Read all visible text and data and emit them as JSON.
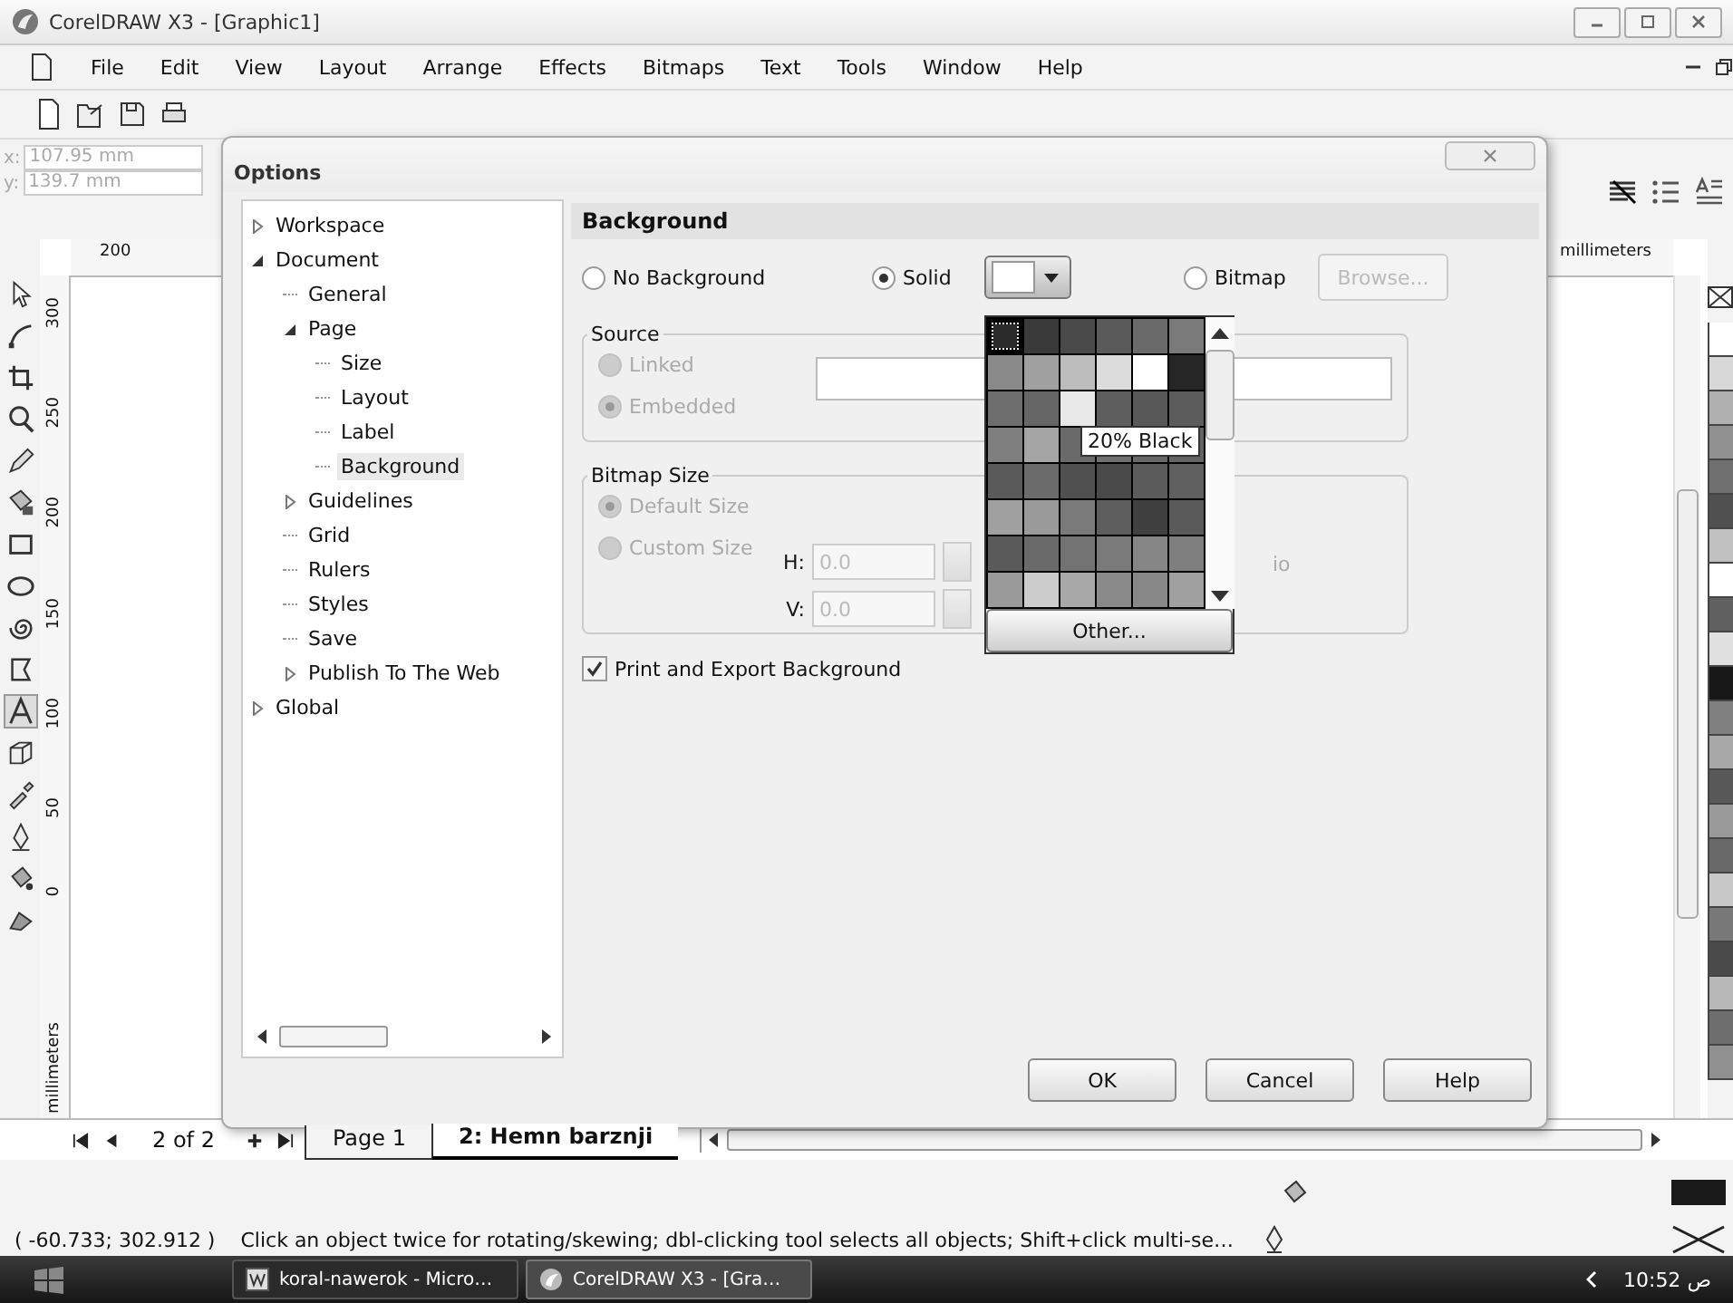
{
  "window": {
    "title": "CorelDRAW X3 - [Graphic1]"
  },
  "menu": [
    "File",
    "Edit",
    "View",
    "Layout",
    "Arrange",
    "Effects",
    "Bitmaps",
    "Text",
    "Tools",
    "Window",
    "Help"
  ],
  "property_bar": {
    "x_label": "x:",
    "x_value": "107.95 mm",
    "y_label": "y:",
    "y_value": "139.7 mm"
  },
  "top_ruler": {
    "tick": "200",
    "unit": "millimeters"
  },
  "left_ruler": {
    "ticks": [
      "300",
      "250",
      "200",
      "150",
      "100",
      "50",
      "0"
    ],
    "unit": "millimeters"
  },
  "dialog": {
    "title": "Options",
    "tree": [
      {
        "label": "Workspace",
        "expanded": false,
        "selected": false
      },
      {
        "label": "Document",
        "expanded": true,
        "selected": false,
        "children": [
          {
            "label": "General",
            "selected": false
          },
          {
            "label": "Page",
            "expanded": true,
            "selected": false,
            "children": [
              {
                "label": "Size",
                "selected": false
              },
              {
                "label": "Layout",
                "selected": false
              },
              {
                "label": "Label",
                "selected": false
              },
              {
                "label": "Background",
                "selected": true
              }
            ]
          },
          {
            "label": "Guidelines",
            "expanded": false,
            "selected": false
          },
          {
            "label": "Grid",
            "selected": false
          },
          {
            "label": "Rulers",
            "selected": false
          },
          {
            "label": "Styles",
            "selected": false
          },
          {
            "label": "Save",
            "selected": false
          },
          {
            "label": "Publish To The Web",
            "expanded": false,
            "selected": false
          }
        ]
      },
      {
        "label": "Global",
        "expanded": false,
        "selected": false
      }
    ],
    "header": "Background",
    "background_types": [
      {
        "label": "No Background",
        "selected": false
      },
      {
        "label": "Solid",
        "selected": true
      },
      {
        "label": "Bitmap",
        "selected": false
      }
    ],
    "color_button": {
      "color": "#ffffff"
    },
    "browse_button": {
      "label": "Browse...",
      "disabled": true
    },
    "source": {
      "legend": "Source",
      "options": [
        {
          "label": "Linked",
          "selected": false,
          "disabled": true
        },
        {
          "label": "Embedded",
          "selected": true,
          "disabled": true
        }
      ]
    },
    "bitmap_size": {
      "legend": "Bitmap Size",
      "options": [
        {
          "label": "Default Size",
          "selected": true,
          "disabled": true
        },
        {
          "label": "Custom Size",
          "selected": false,
          "disabled": true
        }
      ],
      "h_label": "H:",
      "h_value": "0.0",
      "v_label": "V:",
      "v_value": "0.0",
      "partial_label": "io"
    },
    "print_checkbox": {
      "label": "Print and Export Background",
      "checked": true
    },
    "buttons": [
      "OK",
      "Cancel",
      "Help"
    ],
    "color_popup": {
      "other_button": "Other...",
      "tooltip": "20% Black",
      "swatches": [
        {
          "color": "#2a2a2a",
          "selected": true
        },
        {
          "color": "#3a3a3a",
          "selected": false
        },
        {
          "color": "#4a4a4a",
          "selected": false
        },
        {
          "color": "#5a5a5a",
          "selected": false
        },
        {
          "color": "#6a6a6a",
          "selected": false
        },
        {
          "color": "#7a7a7a",
          "selected": false
        },
        {
          "color": "#8a8a8a",
          "selected": false
        },
        {
          "color": "#a0a0a0",
          "selected": false
        },
        {
          "color": "#bcbcbc",
          "selected": false
        },
        {
          "color": "#dcdcdc",
          "selected": false
        },
        {
          "color": "#ffffff",
          "selected": false
        },
        {
          "color": "#262626",
          "selected": false
        },
        {
          "color": "#6e6e6e",
          "selected": false
        },
        {
          "color": "#666666",
          "selected": false
        },
        {
          "color": "#e8e8e8",
          "selected": false
        },
        {
          "color": "#5e5e5e",
          "selected": false
        },
        {
          "color": "#585858",
          "selected": false
        },
        {
          "color": "#5c5c5c",
          "selected": false
        },
        {
          "color": "#7e7e7e",
          "selected": false
        },
        {
          "color": "#a5a5a5",
          "selected": false
        },
        {
          "color": "#6a6a6a",
          "selected": false
        },
        {
          "color": "#707070",
          "selected": false
        },
        {
          "color": "#686868",
          "selected": false
        },
        {
          "color": "#646464",
          "selected": false
        },
        {
          "color": "#5a5a5a",
          "selected": false
        },
        {
          "color": "#6c6c6c",
          "selected": false
        },
        {
          "color": "#505050",
          "selected": false
        },
        {
          "color": "#4a4a4a",
          "selected": false
        },
        {
          "color": "#5b5b5b",
          "selected": false
        },
        {
          "color": "#606060",
          "selected": false
        },
        {
          "color": "#a0a0a0",
          "selected": false
        },
        {
          "color": "#9a9a9a",
          "selected": false
        },
        {
          "color": "#7a7a7a",
          "selected": false
        },
        {
          "color": "#5e5e5e",
          "selected": false
        },
        {
          "color": "#404040",
          "selected": false
        },
        {
          "color": "#5a5a5a",
          "selected": false
        },
        {
          "color": "#5a5a5a",
          "selected": false
        },
        {
          "color": "#6a6a6a",
          "selected": false
        },
        {
          "color": "#737373",
          "selected": false
        },
        {
          "color": "#7a7a7a",
          "selected": false
        },
        {
          "color": "#858585",
          "selected": false
        },
        {
          "color": "#7e7e7e",
          "selected": false
        },
        {
          "color": "#9a9a9a",
          "selected": false
        },
        {
          "color": "#cccccc",
          "selected": false
        },
        {
          "color": "#a8a8a8",
          "selected": false
        },
        {
          "color": "#8a8a8a",
          "selected": false
        },
        {
          "color": "#888888",
          "selected": false
        },
        {
          "color": "#a0a0a0",
          "selected": false
        }
      ]
    }
  },
  "palette": [
    {
      "color": "#ffffff"
    },
    {
      "color": "#d8d8d8"
    },
    {
      "color": "#b0b0b0"
    },
    {
      "color": "#909090"
    },
    {
      "color": "#707070"
    },
    {
      "color": "#505050"
    },
    {
      "color": "#c0c0c0"
    },
    {
      "color": "#ffffff"
    },
    {
      "color": "#606060"
    },
    {
      "color": "#e0e0e0"
    },
    {
      "color": "#181818"
    },
    {
      "color": "#808080"
    },
    {
      "color": "#a8a8a8"
    },
    {
      "color": "#585858"
    },
    {
      "color": "#9a9a9a"
    },
    {
      "color": "#686868"
    },
    {
      "color": "#c8c8c8"
    },
    {
      "color": "#787878"
    },
    {
      "color": "#4a4a4a"
    },
    {
      "color": "#b8b8b8"
    },
    {
      "color": "#6e6e6e"
    },
    {
      "color": "#909090"
    }
  ],
  "page_tabs": {
    "counter": "2 of 2",
    "tabs": [
      {
        "label": "Page 1",
        "selected": false
      },
      {
        "label": "2: Hemn barznji",
        "selected": true
      }
    ]
  },
  "status_bar": {
    "coordinates": "( -60.733; 302.912 )",
    "hint": "Click an object twice for rotating/skewing; dbl-clicking tool selects all objects; Shift+click multi-se…"
  },
  "taskbar": {
    "tasks": [
      {
        "label": "koral-nawerok - Micro…",
        "selected": false
      },
      {
        "label": "CorelDRAW X3 - [Gra…",
        "selected": true
      }
    ],
    "clock": "10:52 ص"
  }
}
